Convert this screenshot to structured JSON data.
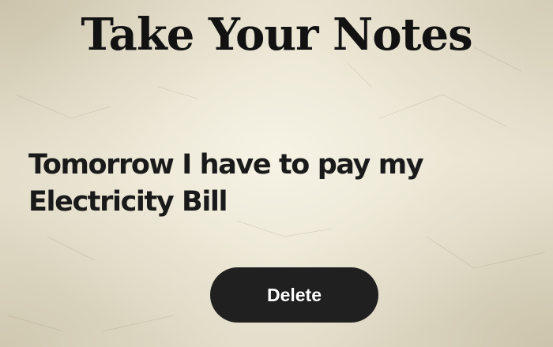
{
  "app": {
    "title": "Take Your Notes"
  },
  "note": {
    "text": "Tomorrow I have to pay my Electricity Bill"
  },
  "actions": {
    "delete_label": "Delete"
  },
  "colors": {
    "background": "#e9e4d2",
    "text": "#121212",
    "button_background": "#202020",
    "button_text": "#ffffff"
  }
}
